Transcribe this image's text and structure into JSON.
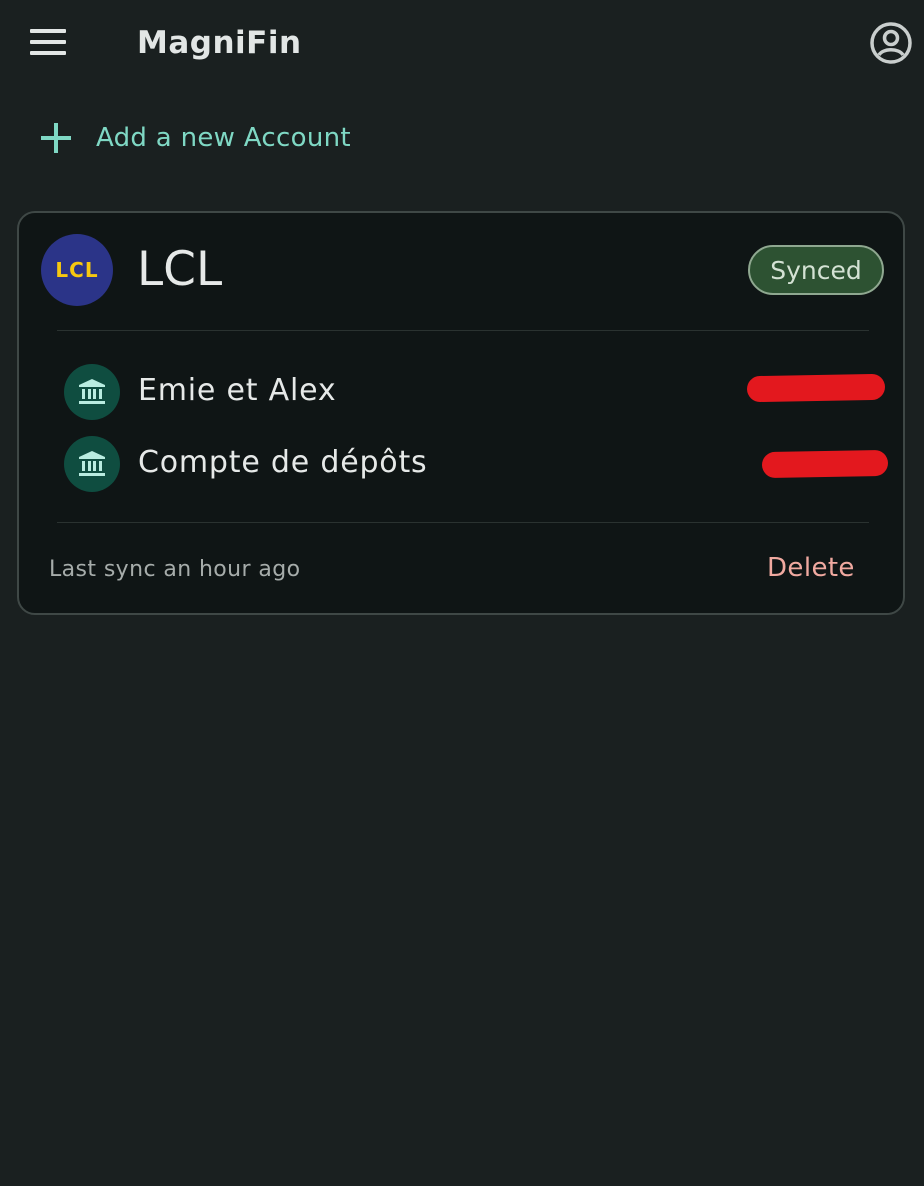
{
  "app_bar": {
    "title": "MagniFin",
    "menu_icon": "hamburger-menu-icon",
    "account_icon": "account-circle-icon"
  },
  "add_account": {
    "icon": "plus-icon",
    "label": "Add a new Account",
    "color": "#7fd8c4"
  },
  "connection_card": {
    "bank": {
      "logo_text": "LCL",
      "name": "LCL",
      "logo_bg": "#2b3488",
      "logo_fg": "#f6c80f"
    },
    "status": "Synced",
    "accounts": [
      {
        "name": "Emie et Alex",
        "icon": "bank-icon",
        "balance_redacted": true
      },
      {
        "name": "Compte de dépôts",
        "icon": "bank-icon",
        "balance_redacted": true
      }
    ],
    "last_sync": "Last sync an hour ago",
    "delete_label": "Delete",
    "delete_color": "#f0a9a0"
  },
  "colors": {
    "background": "#1a2020",
    "card": "#0f1515",
    "status_badge": "#2d5232",
    "redaction": "#e3181e"
  }
}
